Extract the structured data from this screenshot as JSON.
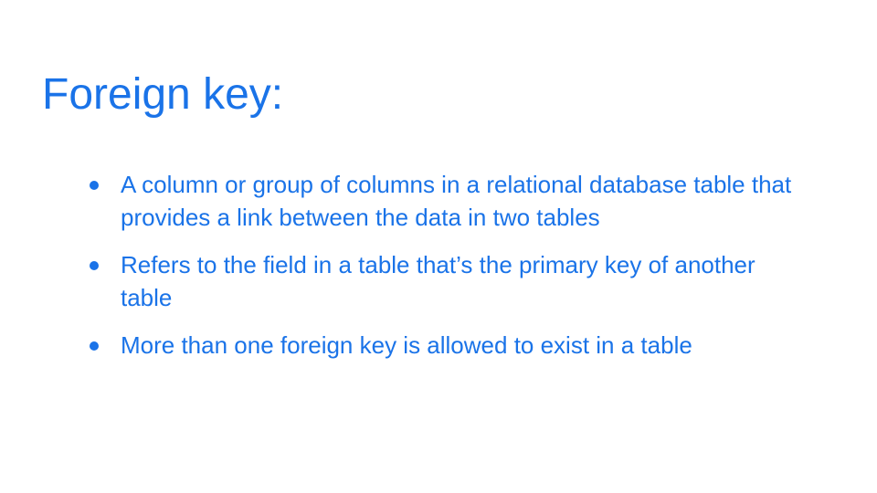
{
  "slide": {
    "title": "Foreign key:",
    "bullets": [
      "A column or group of columns in a relational database table that provides a link between the data in two tables",
      "Refers to the field in a table that’s the primary key of another table",
      "More than one foreign key is allowed to exist in a table"
    ],
    "colors": {
      "accent": "#1a73e8",
      "background": "#ffffff"
    }
  }
}
